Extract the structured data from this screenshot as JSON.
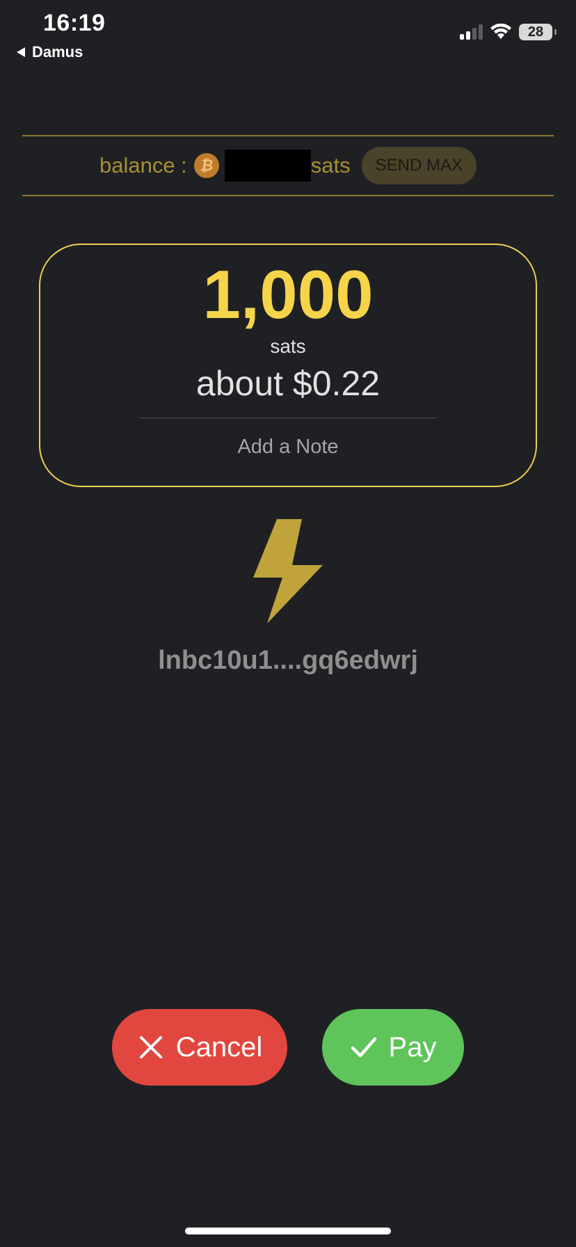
{
  "status_bar": {
    "time": "16:19",
    "back_app": "Damus",
    "battery_level": "28",
    "icons": [
      "cellular-signal-icon",
      "wifi-icon",
      "battery-icon"
    ]
  },
  "balance": {
    "label": "balance :",
    "currency_icon": "bitcoin-icon",
    "amount_hidden": true,
    "unit": "sats",
    "send_max_label": "SEND MAX"
  },
  "amount": {
    "value": "1,000",
    "unit": "sats",
    "fiat": "about $0.22",
    "note_placeholder": "Add a Note"
  },
  "invoice": {
    "icon": "lightning-bolt-icon",
    "text": "lnbc10u1....gq6edwrj"
  },
  "actions": {
    "cancel_label": "Cancel",
    "pay_label": "Pay"
  },
  "colors": {
    "background": "#1f2024",
    "accent": "#f5d44a",
    "cancel": "#e2473f",
    "pay": "#5fc45a"
  }
}
